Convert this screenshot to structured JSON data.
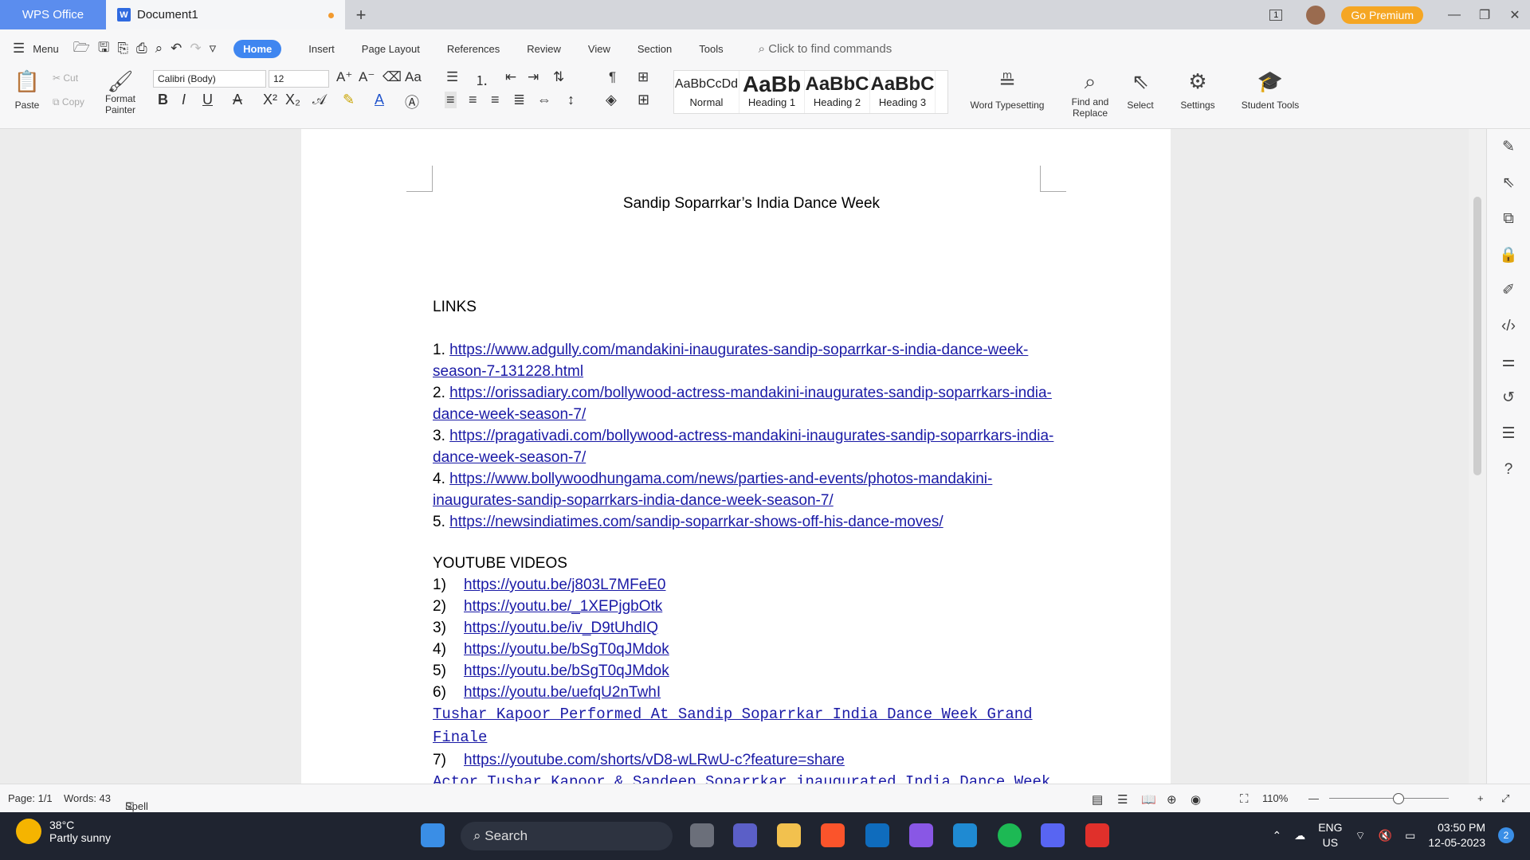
{
  "titlebar": {
    "app_tab": "WPS Office",
    "doc_tab": "Document1",
    "new_tab": "+",
    "premium": "Go Premium",
    "page_badge": "1"
  },
  "menubar": {
    "menu": "Menu",
    "tabs": [
      "Home",
      "Insert",
      "Page Layout",
      "References",
      "Review",
      "View",
      "Section",
      "Tools"
    ],
    "search_placeholder": "Click to find commands"
  },
  "ribbon": {
    "paste": "Paste",
    "cut": "Cut",
    "copy": "Copy",
    "format_painter_1": "Format",
    "format_painter_2": "Painter",
    "font": "Calibri (Body)",
    "size": "12",
    "styles": [
      {
        "preview": "AaBbCcDd",
        "label": "Normal"
      },
      {
        "preview": "AaBb",
        "label": "Heading 1"
      },
      {
        "preview": "AaBbC",
        "label": "Heading 2"
      },
      {
        "preview": "AaBbC",
        "label": "Heading 3"
      }
    ],
    "word_typesetting": "Word Typesetting",
    "find_replace_1": "Find and",
    "find_replace_2": "Replace",
    "select": "Select",
    "settings": "Settings",
    "student_tools": "Student Tools"
  },
  "document": {
    "title": "Sandip Soparrkar’s India Dance Week",
    "links_heading": "LINKS",
    "links": [
      {
        "num": "1.",
        "url": "https://www.adgully.com/mandakini-inaugurates-sandip-soparrkar-s-india-dance-week-season-7-131228.html"
      },
      {
        "num": "2.",
        "url": "https://orissadiary.com/bollywood-actress-mandakini-inaugurates-sandip-soparrkars-india-dance-week-season-7/"
      },
      {
        "num": "3.",
        "url": "https://pragativadi.com/bollywood-actress-mandakini-inaugurates-sandip-soparrkars-india-dance-week-season-7/"
      },
      {
        "num": "4.",
        "url": "https://www.bollywoodhungama.com/news/parties-and-events/photos-mandakini-inaugurates-sandip-soparrkars-india-dance-week-season-7/"
      },
      {
        "num": "5.",
        "url": "https://newsindiatimes.com/sandip-soparrkar-shows-off-his-dance-moves/"
      }
    ],
    "yt_heading": "YOUTUBE VIDEOS",
    "yt": [
      {
        "num": "1)",
        "url": "https://youtu.be/j803L7MFeE0"
      },
      {
        "num": "2)",
        "url": "https://youtu.be/_1XEPjgbOtk"
      },
      {
        "num": "3)",
        "url": "https://youtu.be/iv_D9tUhdIQ"
      },
      {
        "num": "4)",
        "url": "https://youtu.be/bSgT0qJMdok"
      },
      {
        "num": "5)",
        "url": "https://youtu.be/bSgT0qJMdok"
      },
      {
        "num": "6)",
        "url": "https://youtu.be/uefqU2nTwhI"
      }
    ],
    "yt_caption_6": "Tushar Kapoor Performed At Sandip Soparrkar India Dance Week Grand Finale",
    "yt_7": {
      "num": "7)",
      "url": "https://youtube.com/shorts/vD8-wLRwU-c?feature=share"
    },
    "yt_caption_7": "Actor Tushar Kapoor & Sandeep Soparrkar inaugurated India Dance Week"
  },
  "status": {
    "page": "Page: 1/1",
    "words": "Words: 43",
    "spell": "Spell Check",
    "zoom": "110%"
  },
  "taskbar": {
    "temp": "38°C",
    "weather": "Partly sunny",
    "search": "Search",
    "lang1": "ENG",
    "lang2": "US",
    "time": "03:50 PM",
    "date": "12-05-2023",
    "notif": "2"
  }
}
